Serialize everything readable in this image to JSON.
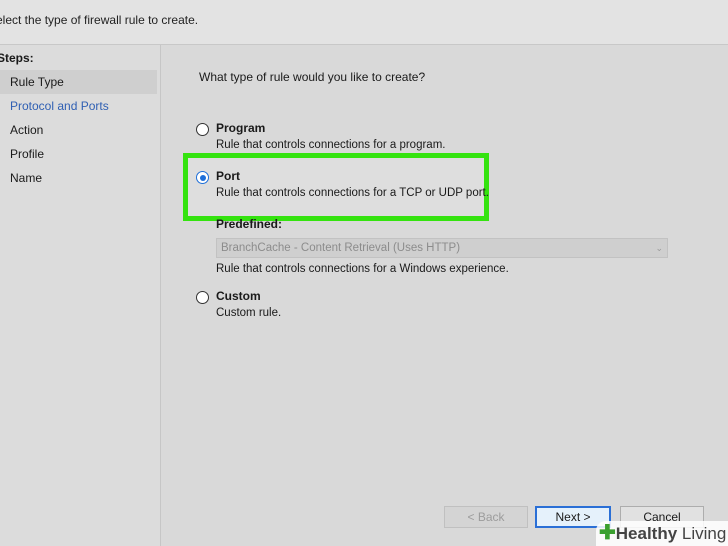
{
  "header": {
    "subtitle": "elect the type of firewall rule to create."
  },
  "steps": {
    "title": "Steps:",
    "items": [
      {
        "label": "Rule Type"
      },
      {
        "label": "Protocol and Ports"
      },
      {
        "label": "Action"
      },
      {
        "label": "Profile"
      },
      {
        "label": "Name"
      }
    ]
  },
  "main": {
    "question": "What type of rule would you like to create?",
    "options": [
      {
        "label": "Program",
        "desc": "Rule that controls connections for a program.",
        "checked": false
      },
      {
        "label": "Port",
        "desc": "Rule that controls connections for a TCP or UDP port.",
        "checked": true
      },
      {
        "label": "Predefined:",
        "desc": "Rule that controls connections for a Windows experience.",
        "checked": false
      },
      {
        "label": "Custom",
        "desc": "Custom rule.",
        "checked": false
      }
    ],
    "predefined_select": "BranchCache - Content Retrieval (Uses HTTP)"
  },
  "buttons": {
    "back": "< Back",
    "next": "Next >",
    "cancel": "Cancel"
  },
  "watermark": {
    "brand_bold": "Healthy",
    "brand_rest": " Living"
  },
  "colors": {
    "highlight": "#34e30f",
    "accent": "#1e6fd9",
    "link": "#2f5fb3"
  }
}
